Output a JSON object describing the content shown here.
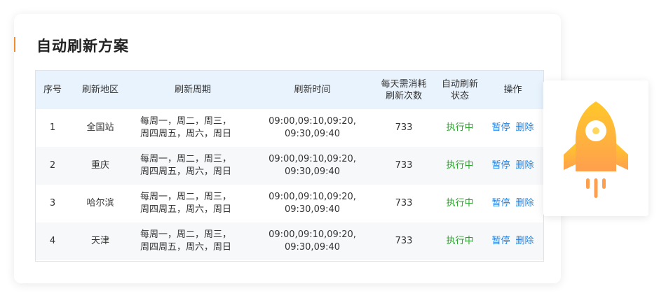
{
  "panel": {
    "title": "自动刷新方案"
  },
  "table": {
    "headers": [
      {
        "line1": "序号",
        "line2": ""
      },
      {
        "line1": "刷新地区",
        "line2": ""
      },
      {
        "line1": "刷新周期",
        "line2": ""
      },
      {
        "line1": "刷新时间",
        "line2": ""
      },
      {
        "line1": "每天需消耗",
        "line2": "刷新次数"
      },
      {
        "line1": "自动刷新",
        "line2": "状态"
      },
      {
        "line1": "操作",
        "line2": ""
      }
    ],
    "rows": [
      {
        "index": "1",
        "region": "全国站",
        "period_line1": "每周一，周二，周三，",
        "period_line2": "周四周五，周六，周日",
        "time_line1": "09:00,09:10,09:20,",
        "time_line2": "09:30,09:40",
        "count": "733",
        "status": "执行中",
        "pause": "暂停",
        "delete": "删除"
      },
      {
        "index": "2",
        "region": "重庆",
        "period_line1": "每周一，周二，周三，",
        "period_line2": "周四周五，周六，周日",
        "time_line1": "09:00,09:10,09:20,",
        "time_line2": "09:30,09:40",
        "count": "733",
        "status": "执行中",
        "pause": "暂停",
        "delete": "删除"
      },
      {
        "index": "3",
        "region": "哈尔滨",
        "period_line1": "每周一，周二，周三，",
        "period_line2": "周四周五，周六，周日",
        "time_line1": "09:00,09:10,09:20,",
        "time_line2": "09:30,09:40",
        "count": "733",
        "status": "执行中",
        "pause": "暂停",
        "delete": "删除"
      },
      {
        "index": "4",
        "region": "天津",
        "period_line1": "每周一，周二，周三，",
        "period_line2": "周四周五，周六，周日",
        "time_line1": "09:00,09:10,09:20,",
        "time_line2": "09:30,09:40",
        "count": "733",
        "status": "执行中",
        "pause": "暂停",
        "delete": "删除"
      }
    ]
  },
  "side_card": {
    "icon": "rocket-icon"
  },
  "colors": {
    "accent": "#f28b2b",
    "header_bg": "#e8f3fe",
    "status_green": "#2aa32a",
    "link_blue": "#1d82e6",
    "rocket_top": "#ffc82a",
    "rocket_bottom": "#ff9f4e"
  }
}
